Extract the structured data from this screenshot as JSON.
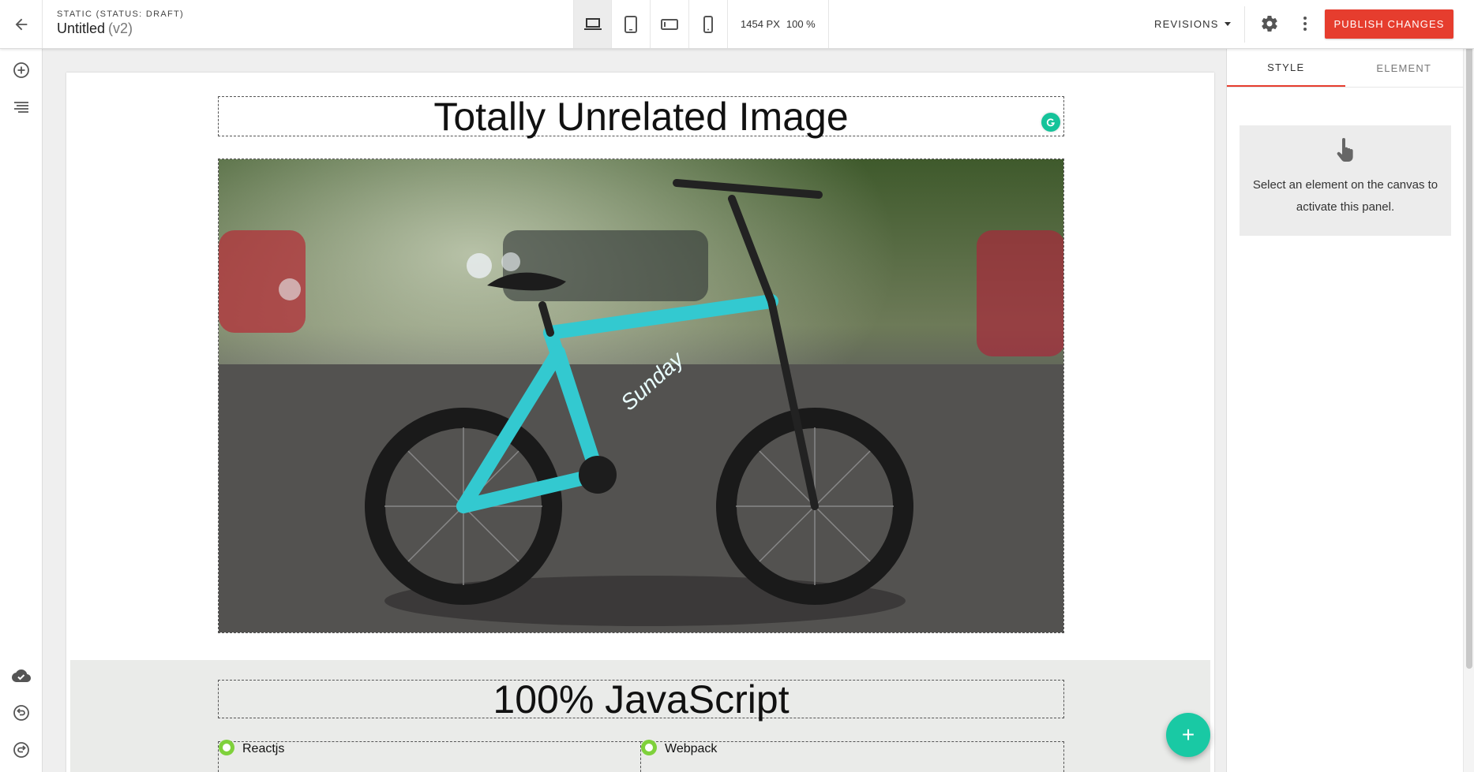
{
  "topbar": {
    "status": "STATIC (STATUS: DRAFT)",
    "title": "Untitled",
    "version": "(v2)",
    "viewport_width": "1454 PX",
    "zoom": "100 %",
    "revisions_label": "REVISIONS",
    "publish_label": "PUBLISH CHANGES",
    "active_device": "desktop",
    "devices": [
      "desktop-icon",
      "tablet-icon",
      "tablet-landscape-icon",
      "phone-icon"
    ]
  },
  "sidebar": {
    "top_icons": [
      "add-circle-icon",
      "layers-list-icon"
    ],
    "bottom_icons": [
      "cloud-saved-icon",
      "undo-history-icon",
      "redo-history-icon"
    ]
  },
  "canvas": {
    "heading": "Totally Unrelated Image",
    "image_alt": "Teal Sunday BMX kids bike on asphalt street",
    "section_heading": "100% JavaScript",
    "list_left": "Reactjs",
    "list_right": "Webpack",
    "fab_label": "+"
  },
  "right_panel": {
    "tabs": [
      "STYLE",
      "ELEMENT"
    ],
    "active_tab": "STYLE",
    "message": "Select an element on the canvas to activate this panel."
  },
  "colors": {
    "accent_red": "#e63d2e",
    "fab_teal": "#19c9a4",
    "bullet_green": "#7fd13b",
    "bike_teal": "#33c9d0"
  }
}
